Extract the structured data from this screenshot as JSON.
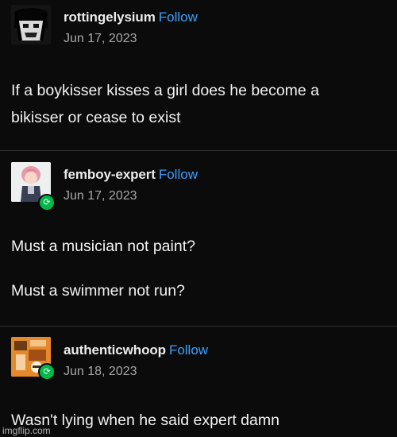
{
  "posts": [
    {
      "username": "rottingelysium",
      "follow_label": "Follow",
      "date": "Jun 17, 2023",
      "reblog_badge": false,
      "avatar_icon": "grunge-portrait-avatar",
      "text": [
        "If a boykisser kisses a girl does he become a",
        "bikisser or cease to exist"
      ]
    },
    {
      "username": "femboy-expert",
      "follow_label": "Follow",
      "date": "Jun 17, 2023",
      "reblog_badge": true,
      "avatar_icon": "anime-character-avatar",
      "text": [
        "Must a musician not paint?",
        "Must a swimmer not run?"
      ]
    },
    {
      "username": "authenticwhoop",
      "follow_label": "Follow",
      "date": "Jun 18, 2023",
      "reblog_badge": true,
      "avatar_icon": "orange-collage-avatar",
      "text": [
        "Wasn't lying when he said expert damn"
      ]
    }
  ],
  "colors": {
    "background": "#0b0b0b",
    "follow": "#3aa0ff",
    "reblog_badge": "#00b84a",
    "date": "#a8a8a8"
  },
  "watermark": "imgflip.com"
}
